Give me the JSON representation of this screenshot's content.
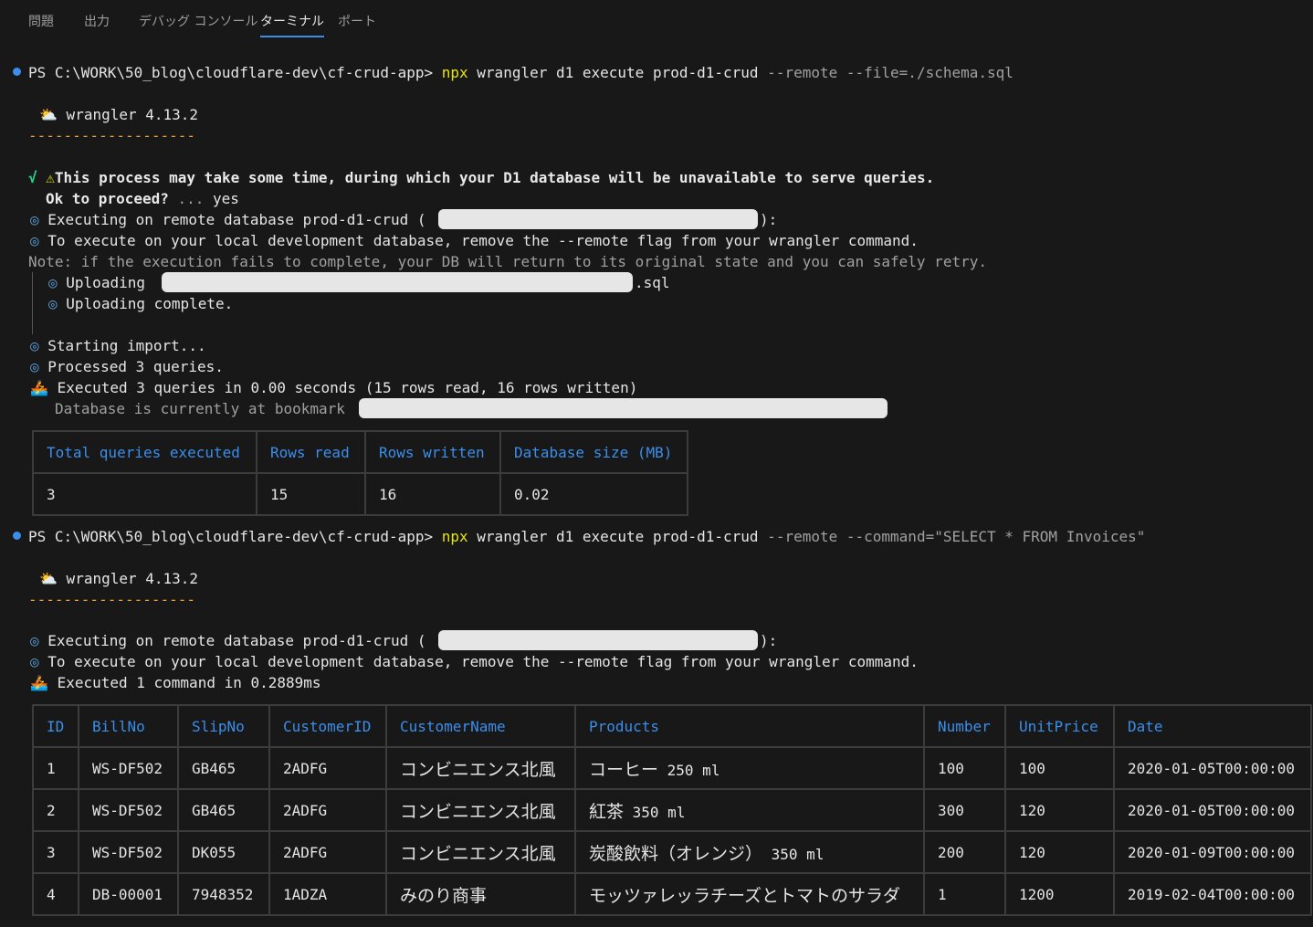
{
  "tabs": [
    "問題",
    "出力",
    "デバッグ コンソール",
    "ターミナル",
    "ポート"
  ],
  "active_tab": "ターミナル",
  "cmd1": {
    "prompt": "PS C:\\WORK\\50_blog\\cloudflare-dev\\cf-crud-app> ",
    "npx": "npx",
    "main": " wrangler d1 execute prod-d1-crud",
    "flags": " --remote --file=./schema.sql"
  },
  "wrangler_banner": " wrangler 4.13.2",
  "dashes": "-------------------",
  "check": "√",
  "warn_line": "This process may take some time, during which your D1 database will be unavailable to serve queries.",
  "proceed_q": "Ok to proceed?",
  "proceed_dots": " ... ",
  "proceed_a": "yes",
  "exec_remote": "Executing on remote database prod-d1-crud (",
  "exec_remote_end": "):",
  "exec_local": "To execute on your local development database, remove the --remote flag from your wrangler command.",
  "note": "Note: if the execution fails to complete, your DB will return to its original state and you can safely retry.",
  "uploading": "Uploading",
  "uploading_ext": ".sql",
  "upload_complete": "Uploading complete.",
  "starting": "Starting import...",
  "processed": "Processed 3 queries.",
  "executed1": "Executed 3 queries in 0.00 seconds (15 rows read, 16 rows written)",
  "bookmark": "Database is currently at bookmark",
  "stats_table": {
    "headers": [
      "Total queries executed",
      "Rows read",
      "Rows written",
      "Database size (MB)"
    ],
    "row": [
      "3",
      "15",
      "16",
      "0.02"
    ]
  },
  "cmd2": {
    "prompt": "PS C:\\WORK\\50_blog\\cloudflare-dev\\cf-crud-app> ",
    "npx": "npx",
    "main": " wrangler d1 execute prod-d1-crud",
    "flags": " --remote --command=\"SELECT * FROM Invoices\""
  },
  "executed2": "Executed 1 command in 0.2889ms",
  "invoices_table": {
    "headers": [
      "ID",
      "BillNo",
      "SlipNo",
      "CustomerID",
      "CustomerName",
      "Products",
      "Number",
      "UnitPrice",
      "Date"
    ],
    "rows": [
      {
        "id": "1",
        "bill": "WS-DF502",
        "slip": "GB465",
        "cust": "2ADFG",
        "name": "コンビニエンス北風",
        "prod_jp": "コーヒー",
        "prod_rest": " 250 ml",
        "num": "100",
        "price": "100",
        "date": "2020-01-05T00:00:00"
      },
      {
        "id": "2",
        "bill": "WS-DF502",
        "slip": "GB465",
        "cust": "2ADFG",
        "name": "コンビニエンス北風",
        "prod_jp": "紅茶",
        "prod_rest": " 350 ml",
        "num": "300",
        "price": "120",
        "date": "2020-01-05T00:00:00"
      },
      {
        "id": "3",
        "bill": "WS-DF502",
        "slip": "DK055",
        "cust": "2ADFG",
        "name": "コンビニエンス北風",
        "prod_jp": "炭酸飲料（オレンジ）",
        "prod_rest": " 350 ml",
        "num": "200",
        "price": "120",
        "date": "2020-01-09T00:00:00"
      },
      {
        "id": "4",
        "bill": "DB-00001",
        "slip": "7948352",
        "cust": "1ADZA",
        "name": "みのり商事",
        "prod_jp": "モッツァレッラチーズとトマトのサラダ",
        "prod_rest": "",
        "num": "1",
        "price": "1200",
        "date": "2019-02-04T00:00:00"
      }
    ]
  },
  "colors": {
    "background": "#181818",
    "accent_blue": "#3b8eea",
    "npx_yellow": "#e5e510",
    "dashes_orange": "#e5a033"
  }
}
